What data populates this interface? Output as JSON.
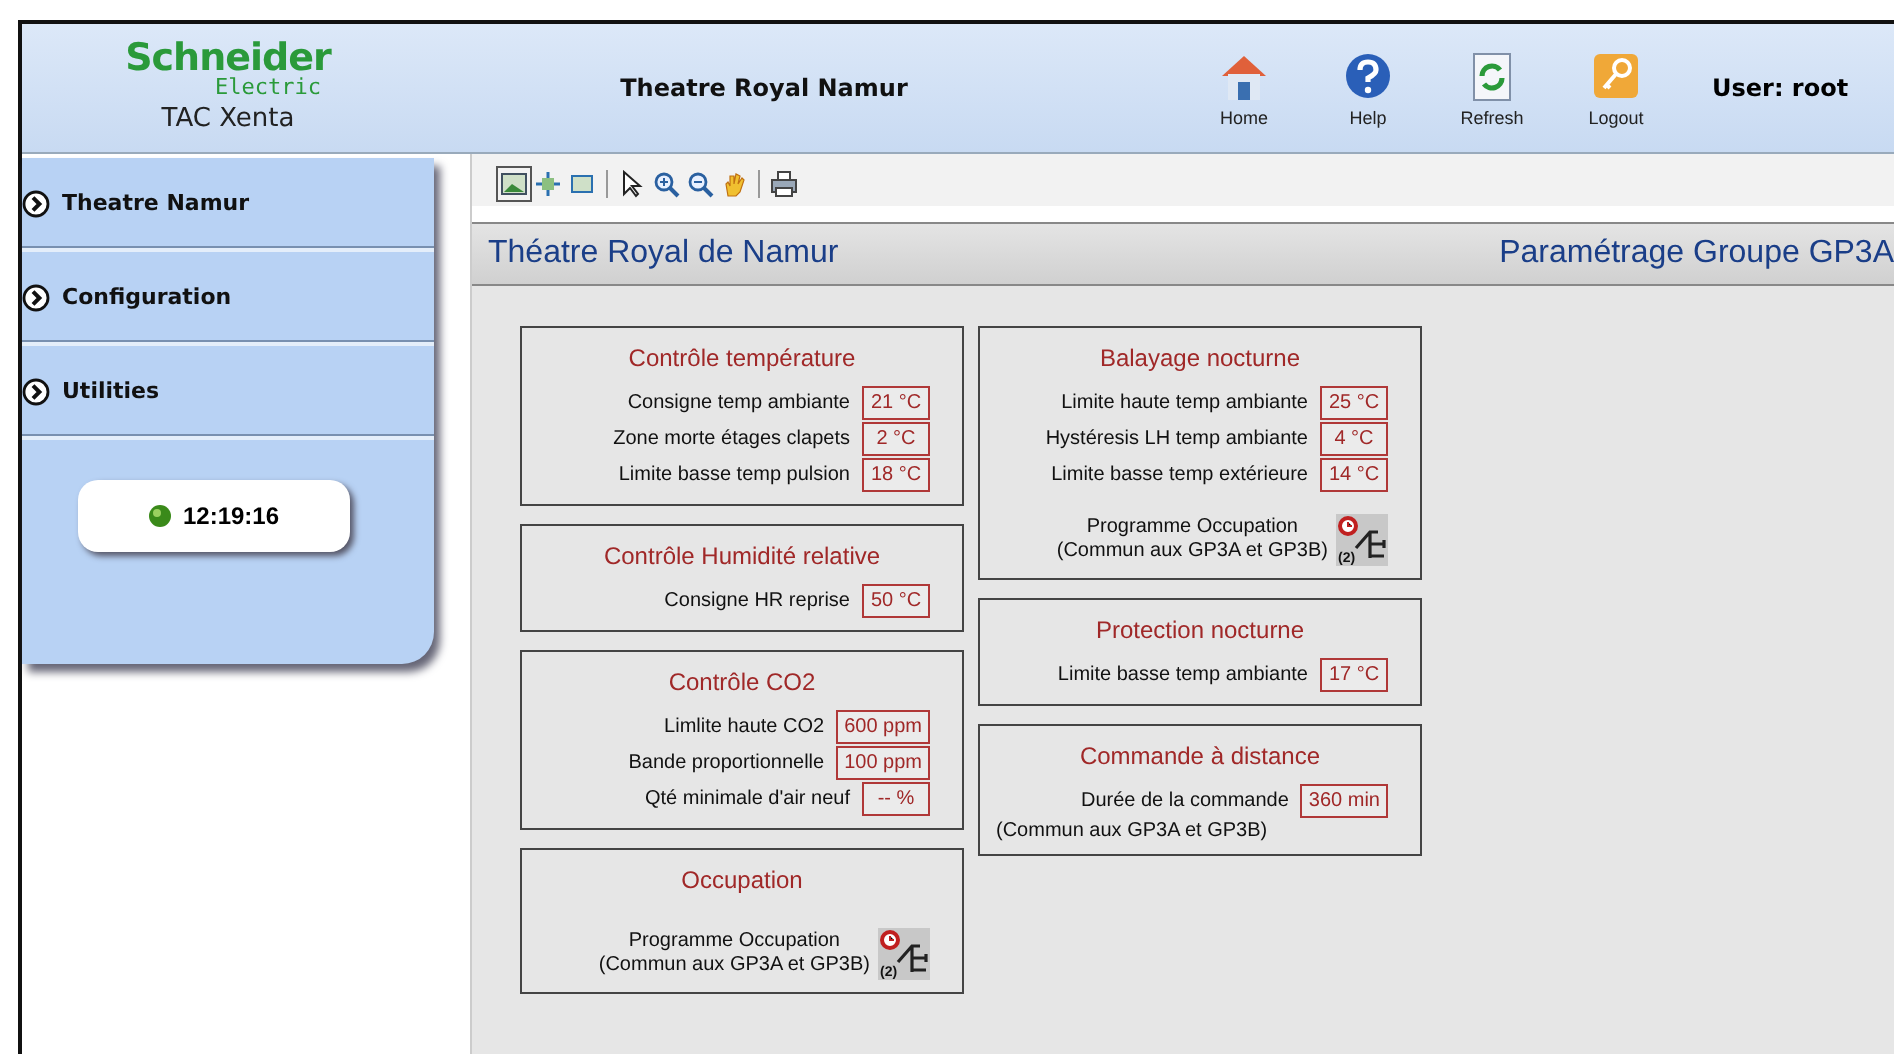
{
  "header": {
    "brand": "Schneider",
    "brand_sub": "Electric",
    "product": "TAC Xenta",
    "title": "Theatre Royal Namur",
    "nav": [
      {
        "kind": "home",
        "label": "Home"
      },
      {
        "kind": "help",
        "label": "Help"
      },
      {
        "kind": "refresh",
        "label": "Refresh"
      },
      {
        "kind": "logout",
        "label": "Logout"
      }
    ],
    "user": "User: root"
  },
  "sidebar": {
    "items": [
      {
        "label": "Theatre Namur"
      },
      {
        "label": "Configuration"
      },
      {
        "label": "Utilities"
      }
    ],
    "clock": "12:19:16"
  },
  "page": {
    "title": "Théatre Royal de Namur",
    "subtitle": "Paramétrage Groupe GP3A"
  },
  "columns": [
    [
      {
        "title": "Contrôle température",
        "items": [
          {
            "kind": "param",
            "label": "Consigne temp ambiante",
            "value": "21 °C"
          },
          {
            "kind": "param",
            "label": "Zone morte étages clapets",
            "value": "2 °C"
          },
          {
            "kind": "param",
            "label": "Limite basse temp pulsion",
            "value": "18 °C"
          }
        ]
      },
      {
        "title": "Contrôle Humidité relative",
        "items": [
          {
            "kind": "param",
            "label": "Consigne HR reprise",
            "value": "50 °C"
          }
        ]
      },
      {
        "title": "Contrôle CO2",
        "items": [
          {
            "kind": "param",
            "label": "Limlite haute CO2",
            "value": "600 ppm"
          },
          {
            "kind": "param",
            "label": "Bande proportionnelle",
            "value": "100 ppm"
          },
          {
            "kind": "param",
            "label": "Qté minimale d'air neuf",
            "value": "-- %"
          }
        ]
      },
      {
        "title": "Occupation",
        "items": [
          {
            "kind": "schedule",
            "lines": [
              "Programme Occupation",
              "(Commun aux GP3A et GP3B)"
            ],
            "badge": "(2)"
          }
        ]
      }
    ],
    [
      {
        "title": "Balayage nocturne",
        "items": [
          {
            "kind": "param",
            "label": "Limite haute temp ambiante",
            "value": "25 °C"
          },
          {
            "kind": "param",
            "label": "Hystéresis LH temp ambiante",
            "value": "4 °C"
          },
          {
            "kind": "param",
            "label": "Limite basse temp extérieure",
            "value": "14 °C"
          },
          {
            "kind": "schedule",
            "lines": [
              "Programme Occupation",
              "(Commun aux GP3A et GP3B)"
            ],
            "badge": "(2)"
          }
        ]
      },
      {
        "title": "Protection nocturne",
        "items": [
          {
            "kind": "param",
            "label": "Limite basse temp ambiante",
            "value": "17 °C"
          }
        ]
      },
      {
        "title": "Commande à distance",
        "items": [
          {
            "kind": "param",
            "label": "Durée de la commande",
            "value": "360 min"
          },
          {
            "kind": "note",
            "text": "(Commun aux GP3A et GP3B)"
          }
        ]
      }
    ]
  ]
}
